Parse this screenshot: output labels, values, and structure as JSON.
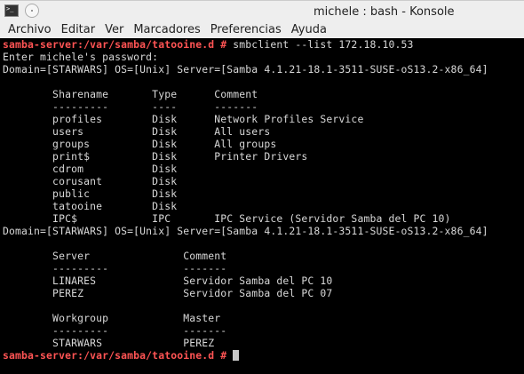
{
  "window": {
    "title": "michele : bash - Konsole"
  },
  "menu": [
    "Archivo",
    "Editar",
    "Ver",
    "Marcadores",
    "Preferencias",
    "Ayuda"
  ],
  "prompt": "samba-server:/var/samba/tatooine.d #",
  "command": " smbclient --list 172.18.10.53",
  "output": [
    "Enter michele's password:",
    "Domain=[STARWARS] OS=[Unix] Server=[Samba 4.1.21-18.1-3511-SUSE-oS13.2-x86_64]",
    "",
    "        Sharename       Type      Comment",
    "        ---------       ----      -------",
    "        profiles        Disk      Network Profiles Service",
    "        users           Disk      All users",
    "        groups          Disk      All groups",
    "        print$          Disk      Printer Drivers",
    "        cdrom           Disk",
    "        corusant        Disk",
    "        public          Disk",
    "        tatooine        Disk",
    "        IPC$            IPC       IPC Service (Servidor Samba del PC 10)",
    "Domain=[STARWARS] OS=[Unix] Server=[Samba 4.1.21-18.1-3511-SUSE-oS13.2-x86_64]",
    "",
    "        Server               Comment",
    "        ---------            -------",
    "        LINARES              Servidor Samba del PC 10",
    "        PEREZ                Servidor Samba del PC 07",
    "",
    "        Workgroup            Master",
    "        ---------            -------",
    "        STARWARS             PEREZ"
  ],
  "colors": {
    "prompt": "#ff5454",
    "text": "#d8d8d8",
    "background": "#000000"
  }
}
